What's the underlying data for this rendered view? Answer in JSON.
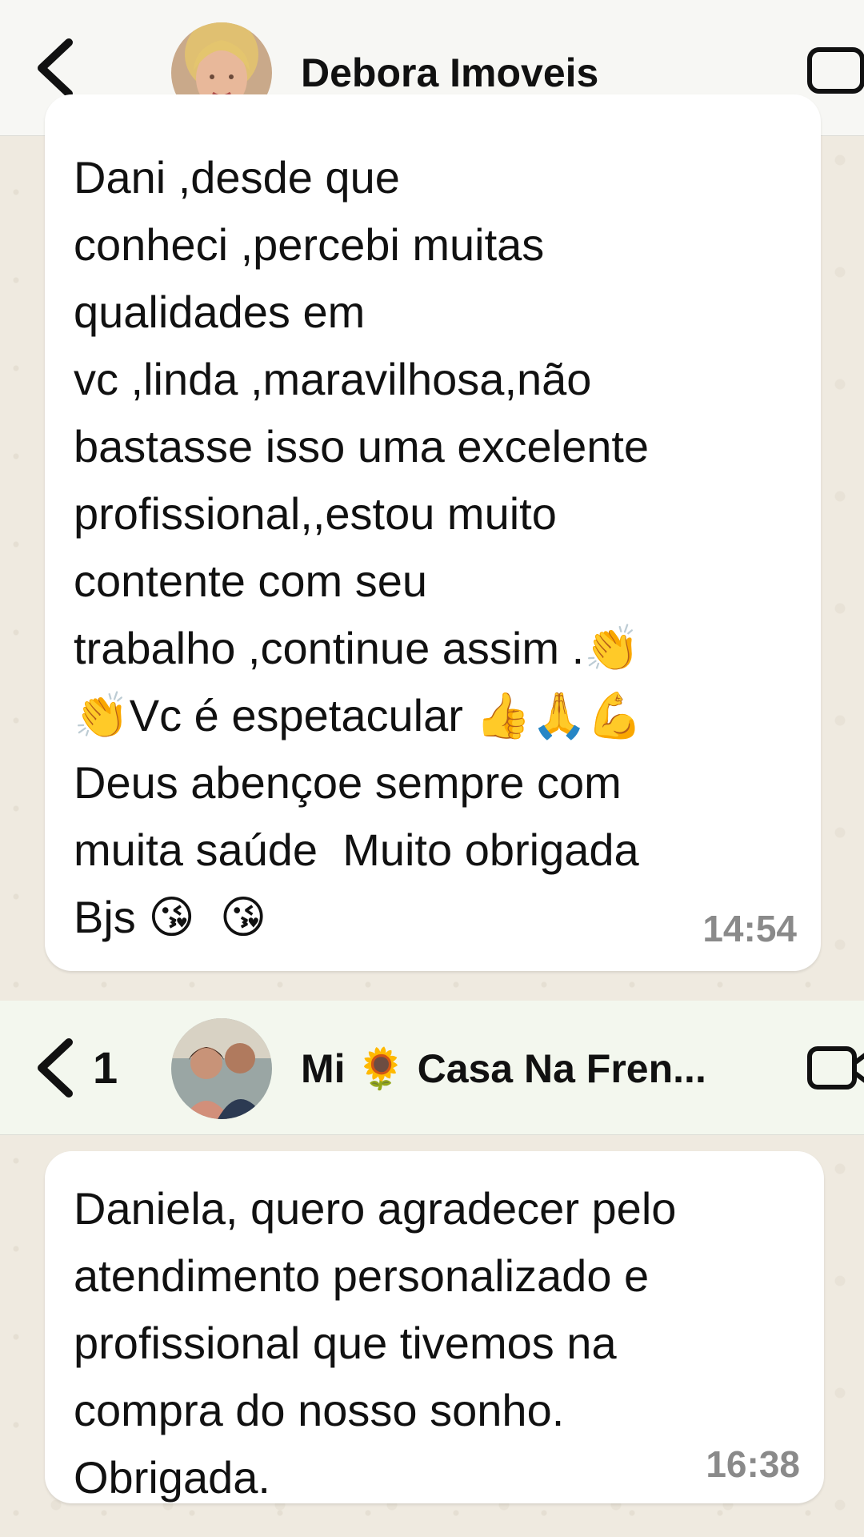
{
  "chats": [
    {
      "header": {
        "contact_name": "Debora Imoveis",
        "back_icon": "chevron-left-icon",
        "video_icon": "video-camera-icon"
      },
      "message": {
        "text": "Dani ,desde que\nconheci ,percebi muitas\nqualidades em\nvc ,linda ,maravilhosa,não\nbastasse isso uma excelente\nprofissional,,estou muito\ncontente com seu\ntrabalho ,continue assim .👏\n👏Vc é espetacular 👍🙏💪\nDeus abençoe sempre com\nmuita saúde  Muito obrigada\nBjs 😘  😘",
        "time": "14:54"
      }
    },
    {
      "header": {
        "back_count": "1",
        "contact_name": "Mi 🌻 Casa Na Fren...",
        "back_icon": "chevron-left-icon",
        "video_icon": "video-camera-icon"
      },
      "message": {
        "text": "Daniela, quero agradecer pelo\natendimento personalizado e\nprofissional que tivemos na\ncompra do nosso sonho.\nObrigada.",
        "time": "16:38"
      }
    }
  ]
}
